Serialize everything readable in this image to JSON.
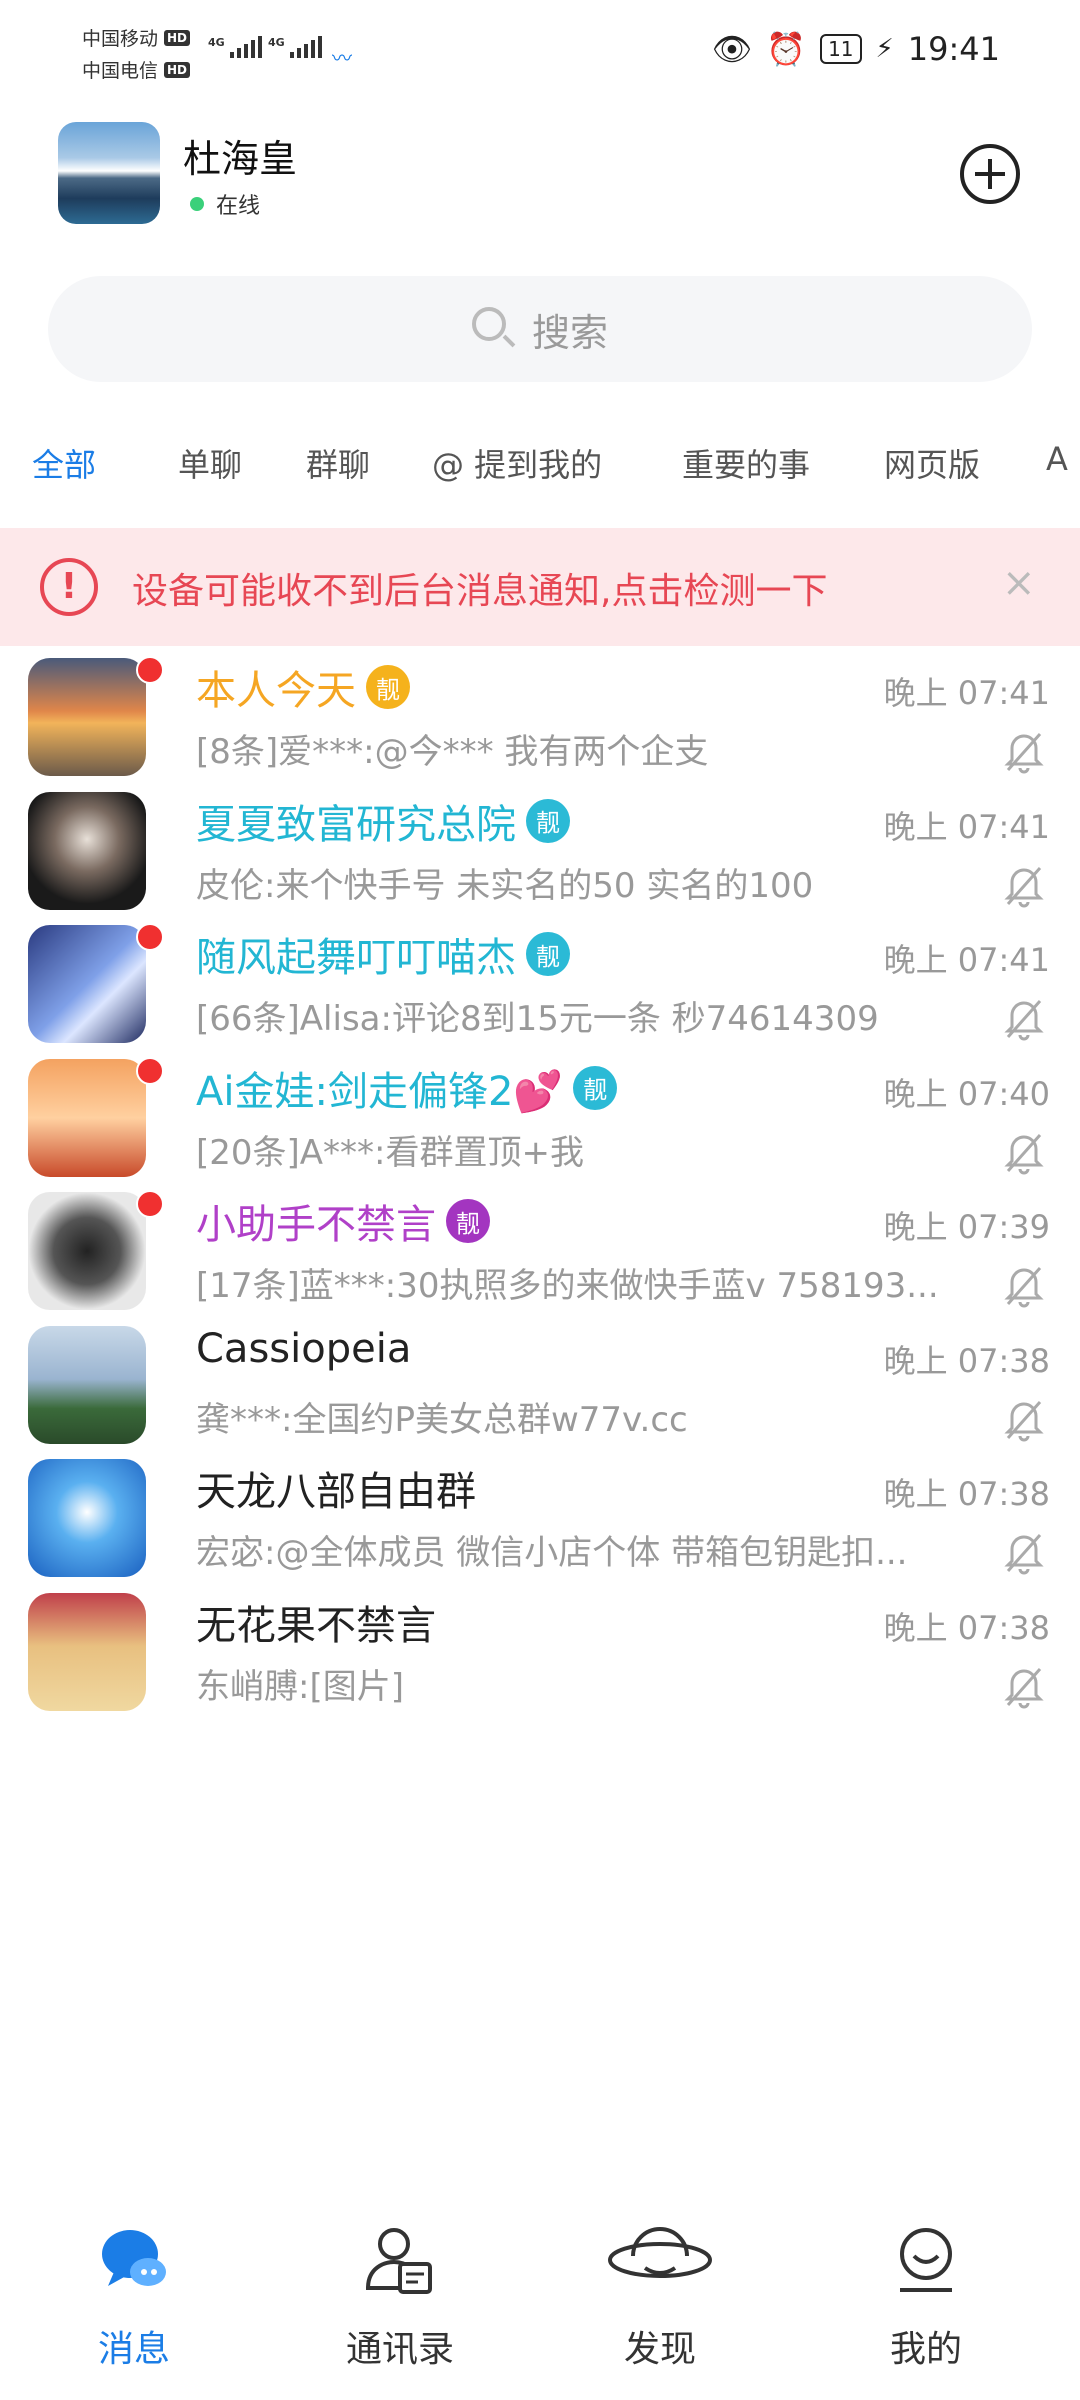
{
  "status_bar": {
    "carrier1": "中国移动",
    "carrier2": "中国电信",
    "hd": "HD",
    "net1": "4G",
    "net2": "4G",
    "battery": "11",
    "time": "19:41"
  },
  "header": {
    "user_name": "杜海皇",
    "status": "在线"
  },
  "search": {
    "placeholder": "搜索"
  },
  "tabs": [
    "全部",
    "单聊",
    "群聊",
    "@ 提到我的",
    "重要的事",
    "网页版",
    "A"
  ],
  "alert": {
    "text": "设备可能收不到后台消息通知,点击检测一下",
    "close": "×"
  },
  "conversations": [
    {
      "name": "本人今天",
      "badge": "靓",
      "name_color": "#f5a623",
      "badge_color": "#f5b21c",
      "time": "晚上 07:41",
      "message": "[8条]爱***:@今*** 我有两个企支",
      "unread": true
    },
    {
      "name": "夏夏致富研究总院",
      "badge": "靓",
      "name_color": "#22b6d3",
      "badge_color": "#2bbad6",
      "time": "晚上 07:41",
      "message": "皮伦:来个快手号 未实名的50 实名的100",
      "unread": false
    },
    {
      "name": "随风起舞叮叮喵杰",
      "badge": "靓",
      "name_color": "#22b6d3",
      "badge_color": "#2bbad6",
      "time": "晚上 07:41",
      "message": "[66条]Alisa:评论8到15元一条 秒74614309",
      "unread": true
    },
    {
      "name": "Ai金娃:剑走偏锋2💕",
      "badge": "靓",
      "name_color": "#22b6d3",
      "badge_color": "#2bbad6",
      "time": "晚上 07:40",
      "message": "[20条]A***:看群置顶+我",
      "unread": true
    },
    {
      "name": "小助手不禁言",
      "badge": "靓",
      "name_color": "#b040c8",
      "badge_color": "#a335c0",
      "time": "晚上 07:39",
      "message": "[17条]蓝***:30执照多的来做快手蓝v 758193...",
      "unread": true
    },
    {
      "name": "Cassiopeia",
      "badge": "",
      "name_color": "#222222",
      "badge_color": "",
      "time": "晚上 07:38",
      "message": "龚***:全国约P美女总群w77v.cc",
      "unread": false
    },
    {
      "name": "天龙八部自由群",
      "badge": "",
      "name_color": "#222222",
      "badge_color": "",
      "time": "晚上 07:38",
      "message": "宏宓:@全体成员 微信小店个体 带箱包钥匙扣...",
      "unread": false
    },
    {
      "name": "无花果不禁言",
      "badge": "",
      "name_color": "#222222",
      "badge_color": "",
      "time": "晚上 07:38",
      "message": "东峭膊:[图片]",
      "unread": false
    }
  ],
  "bottom_nav": [
    {
      "label": "消息",
      "icon": "chat-bubble-icon",
      "active": true
    },
    {
      "label": "通讯录",
      "icon": "contacts-icon",
      "active": false
    },
    {
      "label": "发现",
      "icon": "planet-icon",
      "active": false
    },
    {
      "label": "我的",
      "icon": "profile-icon",
      "active": false
    }
  ],
  "colors": {
    "accent": "#1b7de6",
    "alert": "#e74754",
    "alert_bg": "#fde8ea"
  }
}
